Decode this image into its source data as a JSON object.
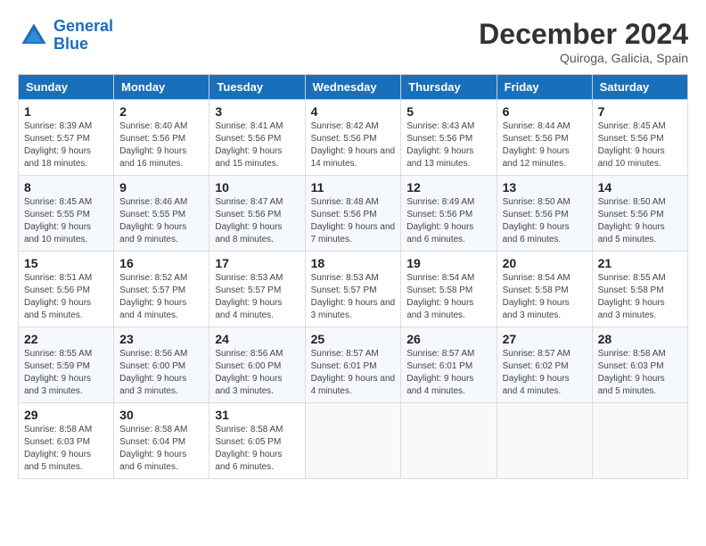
{
  "header": {
    "logo_line1": "General",
    "logo_line2": "Blue",
    "month_title": "December 2024",
    "location": "Quiroga, Galicia, Spain"
  },
  "days_of_week": [
    "Sunday",
    "Monday",
    "Tuesday",
    "Wednesday",
    "Thursday",
    "Friday",
    "Saturday"
  ],
  "weeks": [
    [
      {
        "day": "1",
        "sunrise": "8:39 AM",
        "sunset": "5:57 PM",
        "daylight": "9 hours and 18 minutes."
      },
      {
        "day": "2",
        "sunrise": "8:40 AM",
        "sunset": "5:56 PM",
        "daylight": "9 hours and 16 minutes."
      },
      {
        "day": "3",
        "sunrise": "8:41 AM",
        "sunset": "5:56 PM",
        "daylight": "9 hours and 15 minutes."
      },
      {
        "day": "4",
        "sunrise": "8:42 AM",
        "sunset": "5:56 PM",
        "daylight": "9 hours and 14 minutes."
      },
      {
        "day": "5",
        "sunrise": "8:43 AM",
        "sunset": "5:56 PM",
        "daylight": "9 hours and 13 minutes."
      },
      {
        "day": "6",
        "sunrise": "8:44 AM",
        "sunset": "5:56 PM",
        "daylight": "9 hours and 12 minutes."
      },
      {
        "day": "7",
        "sunrise": "8:45 AM",
        "sunset": "5:56 PM",
        "daylight": "9 hours and 10 minutes."
      }
    ],
    [
      {
        "day": "8",
        "sunrise": "8:45 AM",
        "sunset": "5:55 PM",
        "daylight": "9 hours and 10 minutes."
      },
      {
        "day": "9",
        "sunrise": "8:46 AM",
        "sunset": "5:55 PM",
        "daylight": "9 hours and 9 minutes."
      },
      {
        "day": "10",
        "sunrise": "8:47 AM",
        "sunset": "5:56 PM",
        "daylight": "9 hours and 8 minutes."
      },
      {
        "day": "11",
        "sunrise": "8:48 AM",
        "sunset": "5:56 PM",
        "daylight": "9 hours and 7 minutes."
      },
      {
        "day": "12",
        "sunrise": "8:49 AM",
        "sunset": "5:56 PM",
        "daylight": "9 hours and 6 minutes."
      },
      {
        "day": "13",
        "sunrise": "8:50 AM",
        "sunset": "5:56 PM",
        "daylight": "9 hours and 6 minutes."
      },
      {
        "day": "14",
        "sunrise": "8:50 AM",
        "sunset": "5:56 PM",
        "daylight": "9 hours and 5 minutes."
      }
    ],
    [
      {
        "day": "15",
        "sunrise": "8:51 AM",
        "sunset": "5:56 PM",
        "daylight": "9 hours and 5 minutes."
      },
      {
        "day": "16",
        "sunrise": "8:52 AM",
        "sunset": "5:57 PM",
        "daylight": "9 hours and 4 minutes."
      },
      {
        "day": "17",
        "sunrise": "8:53 AM",
        "sunset": "5:57 PM",
        "daylight": "9 hours and 4 minutes."
      },
      {
        "day": "18",
        "sunrise": "8:53 AM",
        "sunset": "5:57 PM",
        "daylight": "9 hours and 3 minutes."
      },
      {
        "day": "19",
        "sunrise": "8:54 AM",
        "sunset": "5:58 PM",
        "daylight": "9 hours and 3 minutes."
      },
      {
        "day": "20",
        "sunrise": "8:54 AM",
        "sunset": "5:58 PM",
        "daylight": "9 hours and 3 minutes."
      },
      {
        "day": "21",
        "sunrise": "8:55 AM",
        "sunset": "5:58 PM",
        "daylight": "9 hours and 3 minutes."
      }
    ],
    [
      {
        "day": "22",
        "sunrise": "8:55 AM",
        "sunset": "5:59 PM",
        "daylight": "9 hours and 3 minutes."
      },
      {
        "day": "23",
        "sunrise": "8:56 AM",
        "sunset": "6:00 PM",
        "daylight": "9 hours and 3 minutes."
      },
      {
        "day": "24",
        "sunrise": "8:56 AM",
        "sunset": "6:00 PM",
        "daylight": "9 hours and 3 minutes."
      },
      {
        "day": "25",
        "sunrise": "8:57 AM",
        "sunset": "6:01 PM",
        "daylight": "9 hours and 4 minutes."
      },
      {
        "day": "26",
        "sunrise": "8:57 AM",
        "sunset": "6:01 PM",
        "daylight": "9 hours and 4 minutes."
      },
      {
        "day": "27",
        "sunrise": "8:57 AM",
        "sunset": "6:02 PM",
        "daylight": "9 hours and 4 minutes."
      },
      {
        "day": "28",
        "sunrise": "8:58 AM",
        "sunset": "6:03 PM",
        "daylight": "9 hours and 5 minutes."
      }
    ],
    [
      {
        "day": "29",
        "sunrise": "8:58 AM",
        "sunset": "6:03 PM",
        "daylight": "9 hours and 5 minutes."
      },
      {
        "day": "30",
        "sunrise": "8:58 AM",
        "sunset": "6:04 PM",
        "daylight": "9 hours and 6 minutes."
      },
      {
        "day": "31",
        "sunrise": "8:58 AM",
        "sunset": "6:05 PM",
        "daylight": "9 hours and 6 minutes."
      },
      null,
      null,
      null,
      null
    ]
  ]
}
